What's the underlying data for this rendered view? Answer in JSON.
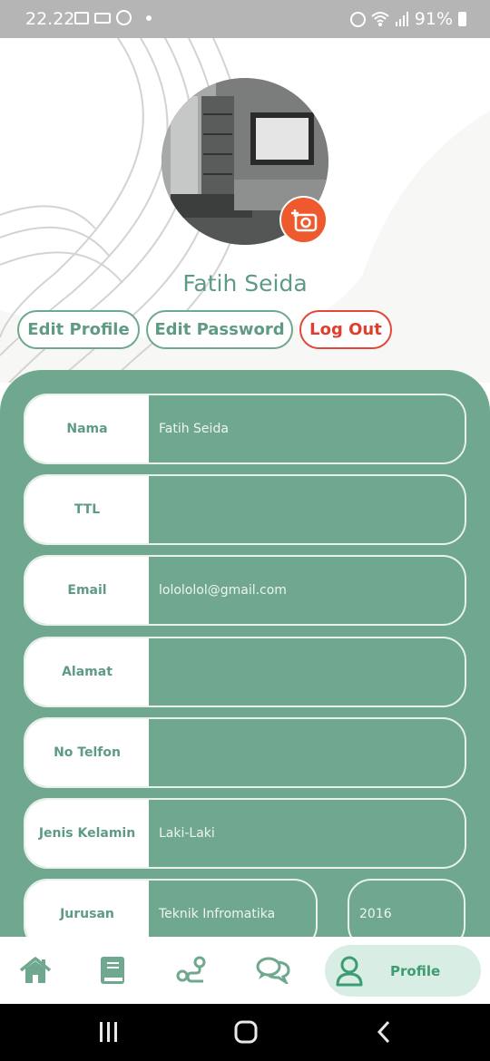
{
  "status_bar": {
    "time": "22.22",
    "battery": "91%",
    "left_icons": [
      "image-icon",
      "laptop-icon",
      "facebook-icon",
      "dot-icon"
    ],
    "right_icons": [
      "alarm-icon",
      "wifi-icon",
      "signal-icon",
      "battery-icon"
    ]
  },
  "profile": {
    "name": "Fatih Seida",
    "camera_icon": "add-photo-icon"
  },
  "actions": {
    "edit_profile": "Edit Profile",
    "edit_password": "Edit Password",
    "logout": "Log Out"
  },
  "fields": [
    {
      "label": "Nama",
      "value": "Fatih Seida"
    },
    {
      "label": "TTL",
      "value": ""
    },
    {
      "label": "Email",
      "value": "lolololol@gmail.com"
    },
    {
      "label": "Alamat",
      "value": ""
    },
    {
      "label": "No Telfon",
      "value": ""
    },
    {
      "label": "Jenis Kelamin",
      "value": "Laki-Laki"
    },
    {
      "label": "Jurusan",
      "value": "Teknik Infromatika",
      "year": "2016"
    }
  ],
  "bottom_nav": {
    "items": [
      "home-icon",
      "book-icon",
      "route-icon",
      "chat-icon",
      "user-icon"
    ],
    "active_label": "Profile"
  },
  "colors": {
    "accent": "#6fa88e",
    "danger": "#e24838",
    "camera_button": "#ee5a2e",
    "nav_active_bg": "#d8ede3"
  }
}
